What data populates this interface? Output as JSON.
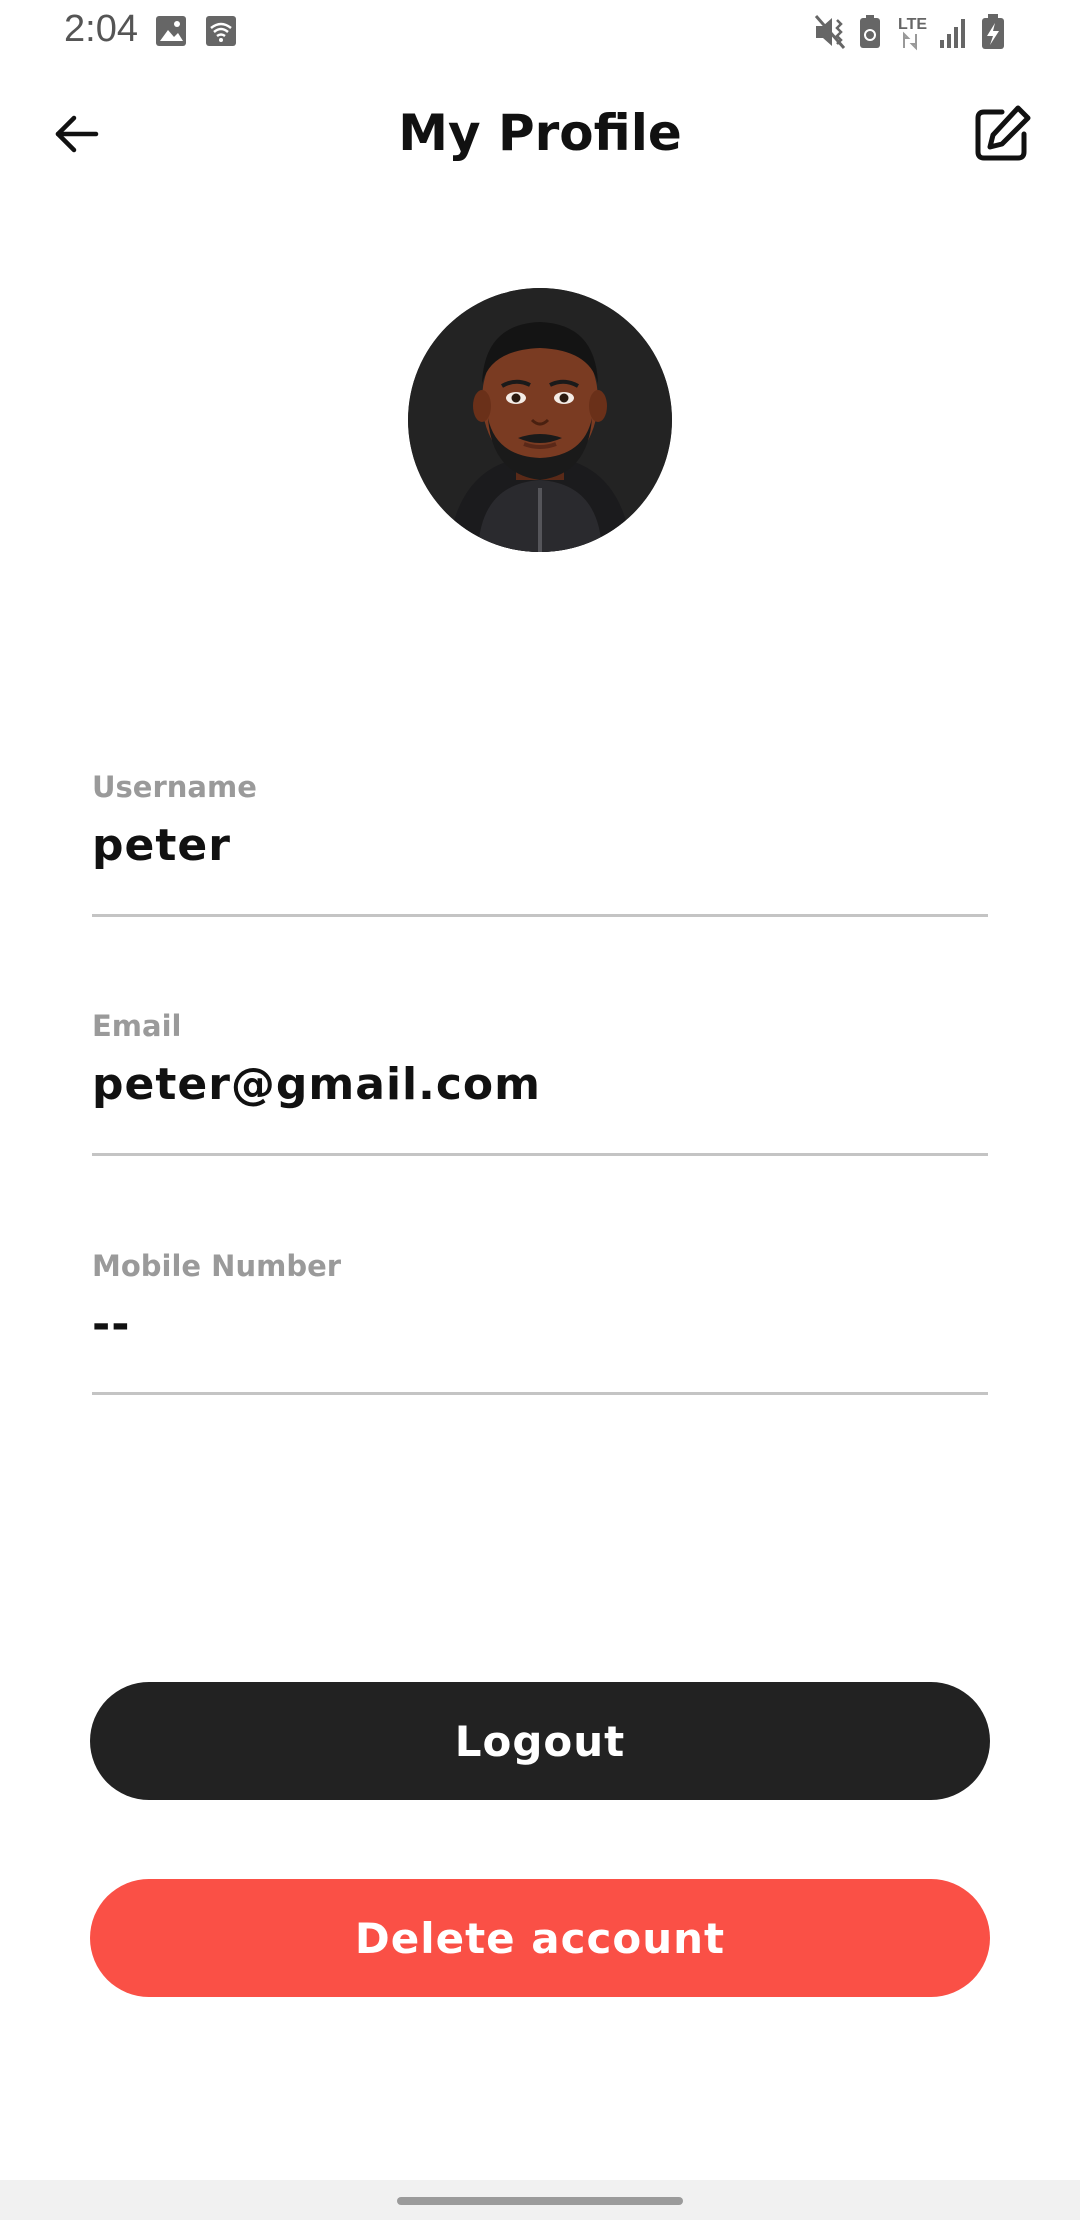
{
  "status_bar": {
    "time": "2:04",
    "network": "LTE",
    "left_icons": [
      "image-icon",
      "wifi-calling-icon"
    ],
    "right_icons": [
      "vibrate-mute-icon",
      "battery-saver-icon",
      "lte-data-icon",
      "signal-icon",
      "battery-charging-icon"
    ]
  },
  "header": {
    "title": "My Profile",
    "back_icon": "arrow-left-icon",
    "edit_icon": "edit-icon"
  },
  "profile": {
    "avatar": "avatar-illustration"
  },
  "fields": [
    {
      "label": "Username",
      "value": "peter"
    },
    {
      "label": "Email",
      "value": "peter@gmail.com"
    },
    {
      "label": "Mobile Number",
      "value": "--"
    }
  ],
  "actions": {
    "logout_label": "Logout",
    "delete_label": "Delete account"
  },
  "colors": {
    "primary_button": "#222222",
    "danger_button": "#fa5046",
    "field_label": "#9a9a9a",
    "divider": "#c4c4c4"
  }
}
